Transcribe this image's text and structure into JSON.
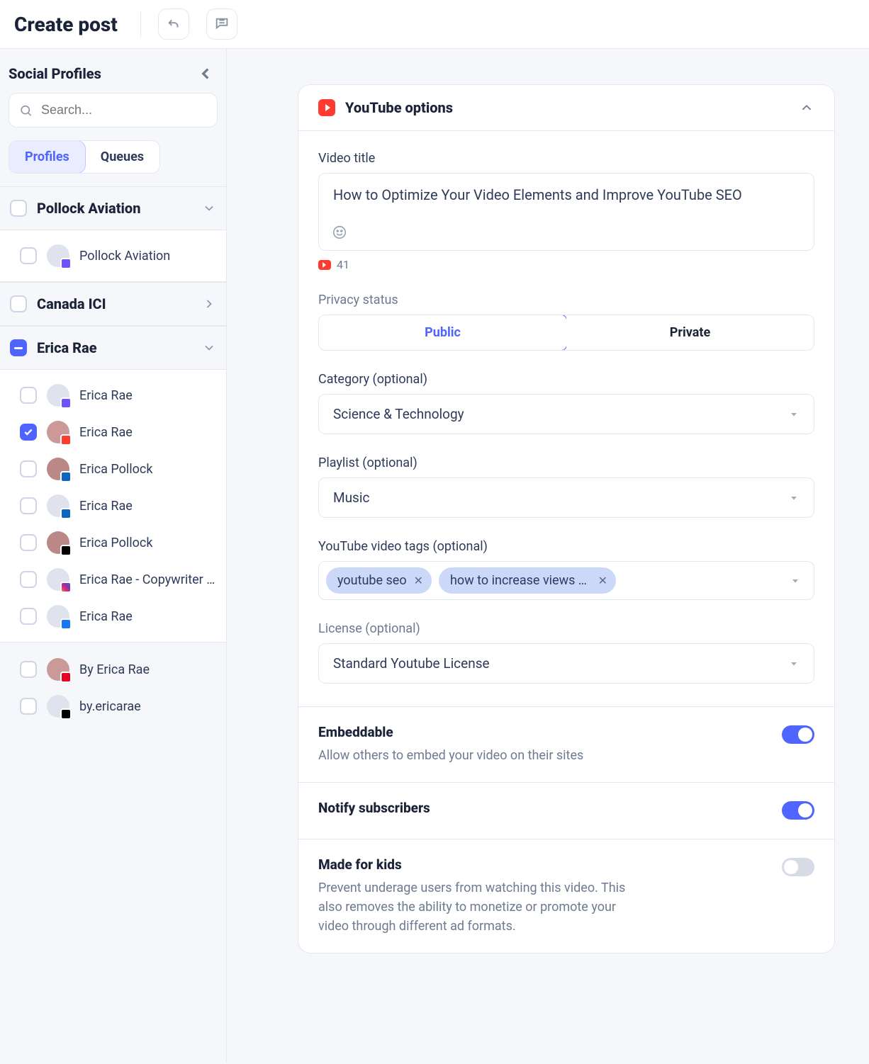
{
  "header": {
    "title": "Create post"
  },
  "sidebar": {
    "title": "Social Profiles",
    "search_placeholder": "Search...",
    "tabs": {
      "profiles": "Profiles",
      "queues": "Queues",
      "active": "profiles"
    },
    "groups": [
      {
        "key": "pollock-aviation",
        "name": "Pollock Aviation",
        "checked": false,
        "expanded": true,
        "profiles": [
          {
            "name": "Pollock Aviation",
            "network": "generic",
            "checked": false
          }
        ]
      },
      {
        "key": "canada-ici",
        "name": "Canada ICI",
        "checked": false,
        "expanded": false,
        "profiles": []
      },
      {
        "key": "erica-rae",
        "name": "Erica Rae",
        "checked": "indeterminate",
        "expanded": true,
        "profiles": [
          {
            "name": "Erica Rae",
            "network": "generic",
            "checked": false
          },
          {
            "name": "Erica Rae",
            "network": "yt",
            "checked": true
          },
          {
            "name": "Erica Pollock",
            "network": "li",
            "checked": false
          },
          {
            "name": "Erica Rae",
            "network": "li",
            "checked": false
          },
          {
            "name": "Erica Pollock",
            "network": "x",
            "checked": false
          },
          {
            "name": "Erica Rae - Copywriter …",
            "network": "ig",
            "checked": false
          },
          {
            "name": "Erica Rae",
            "network": "fb",
            "checked": false
          }
        ]
      }
    ],
    "extras": [
      {
        "name": "By Erica Rae",
        "network": "pn",
        "checked": false
      },
      {
        "name": "by.ericarae",
        "network": "tt",
        "checked": false
      }
    ]
  },
  "youtube_panel": {
    "title": "YouTube options",
    "video_title_label": "Video title",
    "video_title_value": "How to Optimize Your Video Elements and Improve YouTube SEO",
    "char_count": "41",
    "privacy_label": "Privacy status",
    "privacy_options": {
      "public": "Public",
      "private": "Private",
      "selected": "public"
    },
    "category_label": "Category (optional)",
    "category_value": "Science & Technology",
    "playlist_label": "Playlist (optional)",
    "playlist_value": "Music",
    "tags_label": "YouTube video tags (optional)",
    "tags": [
      "youtube seo",
      "how to increase views on …"
    ],
    "license_label": "License (optional)",
    "license_value": "Standard Youtube License",
    "switches": [
      {
        "key": "embeddable",
        "title": "Embeddable",
        "desc": "Allow others to embed your video on their sites",
        "on": true
      },
      {
        "key": "notify",
        "title": "Notify subscribers",
        "desc": "",
        "on": true
      },
      {
        "key": "kids",
        "title": "Made for kids",
        "desc": "Prevent underage users from watching this video. This also removes the ability to monetize or promote your video through different ad formats.",
        "on": false
      }
    ]
  }
}
